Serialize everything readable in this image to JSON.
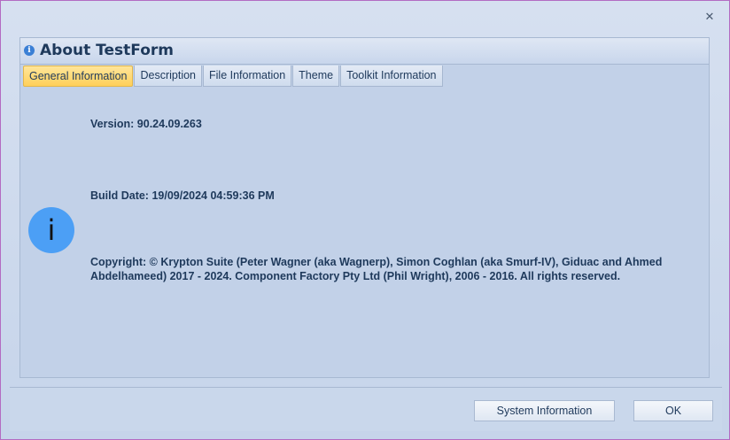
{
  "window": {
    "close_glyph": "✕",
    "close_icon": "close-icon"
  },
  "header": {
    "title": "About TestForm",
    "icon": "info-small-icon"
  },
  "tabs": [
    {
      "label": "General Information",
      "active": true
    },
    {
      "label": "Description",
      "active": false
    },
    {
      "label": "File Information",
      "active": false
    },
    {
      "label": "Theme",
      "active": false
    },
    {
      "label": "Toolkit Information",
      "active": false
    }
  ],
  "general": {
    "icon_glyph": "i",
    "version": "Version: 90.24.09.263",
    "build_date": "Build Date: 19/09/2024 04:59:36 PM",
    "copyright": "Copyright: © Krypton Suite (Peter Wagner (aka Wagnerp), Simon Coghlan (aka Smurf-IV), Giduac and Ahmed Abdelhameed) 2017 - 2024. Component Factory Pty Ltd (Phil Wright), 2006 - 2016. All rights reserved."
  },
  "footer": {
    "system_info_label": "System Information",
    "ok_label": "OK"
  },
  "colors": {
    "accent_tab": "#ffd05a",
    "text": "#1e395b",
    "info_icon": "#4c9ff5"
  }
}
